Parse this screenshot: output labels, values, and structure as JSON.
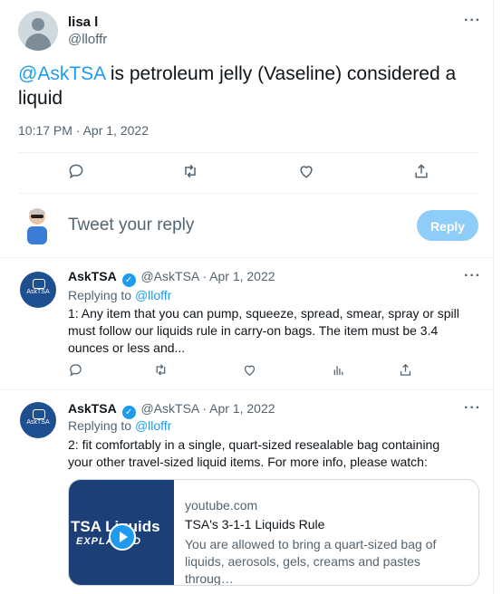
{
  "main_tweet": {
    "name": "lisa l",
    "handle": "@lloffr",
    "mention": "@AskTSA",
    "text": " is petroleum jelly (Vaseline) considered a liquid",
    "time": "10:17 PM · Apr 1, 2022",
    "more": "···"
  },
  "reply_box": {
    "placeholder": "Tweet your reply",
    "button": "Reply"
  },
  "replies": [
    {
      "name": "AskTSA",
      "verified": "✓",
      "handle": "@AskTSA",
      "date": "· Apr 1, 2022",
      "replying_prefix": "Replying to ",
      "replying_to": "@lloffr",
      "text": "1: Any item that you can pump, squeeze, spread, smear, spray or spill must follow our liquids rule in carry-on bags. The item must be 3.4 ounces or less and...",
      "avatar_label": "AskTSA",
      "more": "···"
    },
    {
      "name": "AskTSA",
      "verified": "✓",
      "handle": "@AskTSA",
      "date": "· Apr 1, 2022",
      "replying_prefix": "Replying to ",
      "replying_to": "@lloffr",
      "text": "2: fit comfortably in a single, quart-sized resealable bag containing your other travel-sized liquid items. For more info, please watch:",
      "avatar_label": "AskTSA",
      "more": "···"
    }
  ],
  "link_card": {
    "domain": "youtube.com",
    "title": "TSA's 3-1-1 Liquids Rule",
    "description": "You are allowed to bring a quart-sized bag of liquids, aerosols, gels, creams and pastes throug…",
    "image_text_1": "TSA Liquids",
    "image_text_2": "EXPLAINED"
  },
  "colors": {
    "accent": "#1d9bf0",
    "muted": "#536471",
    "tsa_blue": "#1d4f91"
  }
}
